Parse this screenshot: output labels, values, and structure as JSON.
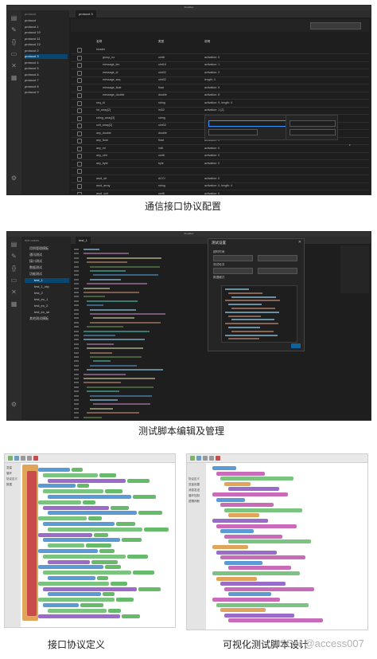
{
  "panels": [
    {
      "caption": "通信接口协议配置",
      "app_title": "FlowDev",
      "side_title": "protocol",
      "sidebar_items": [
        "protocol",
        "protocol 1",
        "protocol 10",
        "protocol 11",
        "protocol 12",
        "protocol 2",
        "protocol 3",
        "protocol 4",
        "protocol 5",
        "protocol 6",
        "protocol 7",
        "protocol 8",
        "protocol 9"
      ],
      "selected_index": 6,
      "tab": "protocol 3",
      "table_headers": [
        "名称",
        "类型",
        "说明"
      ],
      "table_rows": [
        [
          "header",
          "",
          ""
        ],
        [
          "group_no",
          "uint8",
          "activation: 0"
        ],
        [
          "message_len",
          "uint16",
          "activation: 1"
        ],
        [
          "message_id",
          "uint32",
          "activation: 2"
        ],
        [
          "message_seq",
          "uint32",
          "length: 4"
        ],
        [
          "message_float",
          "float",
          "activation: 5"
        ],
        [
          "message_double",
          "double",
          "activation: 8"
        ],
        [
          "seq_id",
          "string",
          "activation: 9, length: 4"
        ],
        [
          "int_array[2]",
          "int32",
          "activation: 1 {2}"
        ],
        [
          "string_array[3]",
          "string",
          "activation: 0"
        ],
        [
          "unit_array[2]",
          "uint32",
          "activation: 0"
        ],
        [
          "any_double",
          "double",
          "activation: 0"
        ],
        [
          "any_float",
          "float",
          "activation: 0"
        ],
        [
          "any_int",
          "int8",
          "activation: 0"
        ],
        [
          "any_uint",
          "uint8",
          "activation: 0"
        ],
        [
          "any_byte",
          "byte",
          "activation: 0"
        ],
        [
          "",
          "",
          ""
        ],
        [
          "ascii_str",
          "ACCI",
          "activation: 0"
        ],
        [
          "ascii_array",
          "string",
          "activation: 0, length: 4"
        ],
        [
          "ascii_unit",
          "uint8",
          "activation: 0"
        ]
      ]
    },
    {
      "caption": "测试脚本编辑及管理",
      "app_title": "FlowDev",
      "side_title": "test cases",
      "sidebar_items": [
        "用例管理模板",
        "通讯测试",
        "接口测试",
        "数据测试",
        "功能测试",
        "test_1",
        "test_1_ntp",
        "test_2",
        "test_ex_1",
        "test_ex_2",
        "test_ex_str",
        "其他测试模板"
      ],
      "selected_index": 5,
      "tab": "test_1",
      "dialog_title": "测试设置",
      "dialog_fields": [
        "超时时间",
        "测试轮次",
        "数据格式"
      ]
    }
  ],
  "bottom_captions": [
    "接口协议定义",
    "可视化测试脚本设计"
  ],
  "left_palette": [
    "变量",
    "循环",
    "协议定义",
    "数据"
  ],
  "right_palette": [
    "协议定义",
    "变量设置",
    "消息发送",
    "循环控制",
    "逻辑判断"
  ],
  "watermark": "CSDN @access007"
}
